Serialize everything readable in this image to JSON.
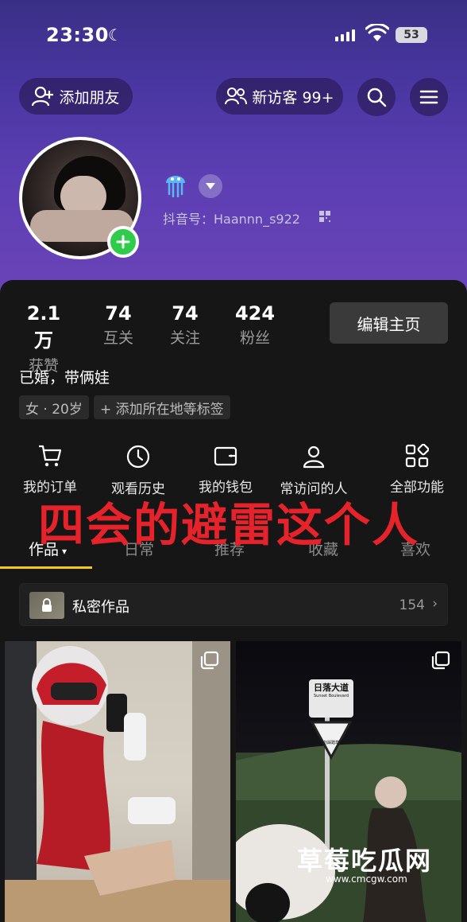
{
  "status_bar": {
    "time": "23:30",
    "battery": "53"
  },
  "header": {
    "add_friend_label": "添加朋友",
    "visitors_label": "新访客 99+"
  },
  "profile": {
    "douyin_id_label": "抖音号：Haannn_s922",
    "bio": "已婚，带俩娃",
    "tags": [
      "女 · 20岁",
      "+ 添加所在地等标签"
    ]
  },
  "stats": [
    {
      "value": "2.1万",
      "label": "获赞"
    },
    {
      "value": "74",
      "label": "互关"
    },
    {
      "value": "74",
      "label": "关注"
    },
    {
      "value": "424",
      "label": "粉丝"
    }
  ],
  "edit_profile_label": "编辑主页",
  "functions": [
    {
      "label": "我的订单",
      "icon": "cart-icon"
    },
    {
      "label": "观看历史",
      "icon": "clock-icon"
    },
    {
      "label": "我的钱包",
      "icon": "wallet-icon"
    },
    {
      "label": "常访问的人",
      "icon": "person-icon"
    },
    {
      "label": "全部功能",
      "icon": "grid-icon"
    }
  ],
  "overlay_caption": "四会的避雷这个人",
  "tabs": [
    "作品",
    "日常",
    "推荐",
    "收藏",
    "喜欢"
  ],
  "private_works": {
    "label": "私密作品",
    "count": "154"
  },
  "watermark": {
    "text": "草莓吃瓜网",
    "url": "www.cmcgw.com"
  },
  "thumb2_sign": {
    "title": "日落大道",
    "subtitle": "Sunset Boulevard",
    "warning": "请勿踩踏草坪"
  },
  "colors": {
    "accent_yellow": "#f5c81c",
    "overlay_red": "#e6232b",
    "plus_green": "#2ecc4a"
  }
}
